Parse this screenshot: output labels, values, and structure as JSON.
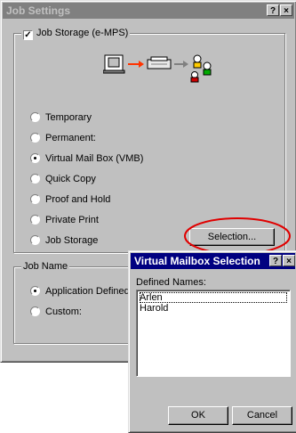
{
  "main_dialog": {
    "title": "Job Settings",
    "help_glyph": "?",
    "close_glyph": "×",
    "job_storage_check_label": "Job Storage (e-MPS)",
    "job_storage_checked": true,
    "options": [
      {
        "label": "Temporary",
        "selected": false
      },
      {
        "label": "Permanent:",
        "selected": false
      },
      {
        "label": "Virtual Mail Box (VMB)",
        "selected": true
      },
      {
        "label": "Quick Copy",
        "selected": false
      },
      {
        "label": "Proof and Hold",
        "selected": false
      },
      {
        "label": "Private Print",
        "selected": false
      },
      {
        "label": "Job Storage",
        "selected": false
      }
    ],
    "selection_button": "Selection...",
    "job_name_group": "Job Name",
    "job_name_options": [
      {
        "label": "Application Defined",
        "selected": true
      },
      {
        "label": "Custom:",
        "selected": false
      }
    ]
  },
  "vmb_dialog": {
    "title": "Virtual Mailbox Selection",
    "help_glyph": "?",
    "close_glyph": "×",
    "defined_names_label": "Defined Names:",
    "names": [
      "Arlen",
      "Harold"
    ],
    "ok_button": "OK",
    "cancel_button": "Cancel"
  },
  "icons": {
    "computer": "monitor-icon",
    "arrow_red": "red-arrow-icon",
    "printer": "printer-icon",
    "arrow_gray": "gray-arrow-icon",
    "users": "users-icon"
  },
  "colors": {
    "highlight_ellipse": "#e00000",
    "active_title": "#000080",
    "inactive_title": "#808080"
  }
}
